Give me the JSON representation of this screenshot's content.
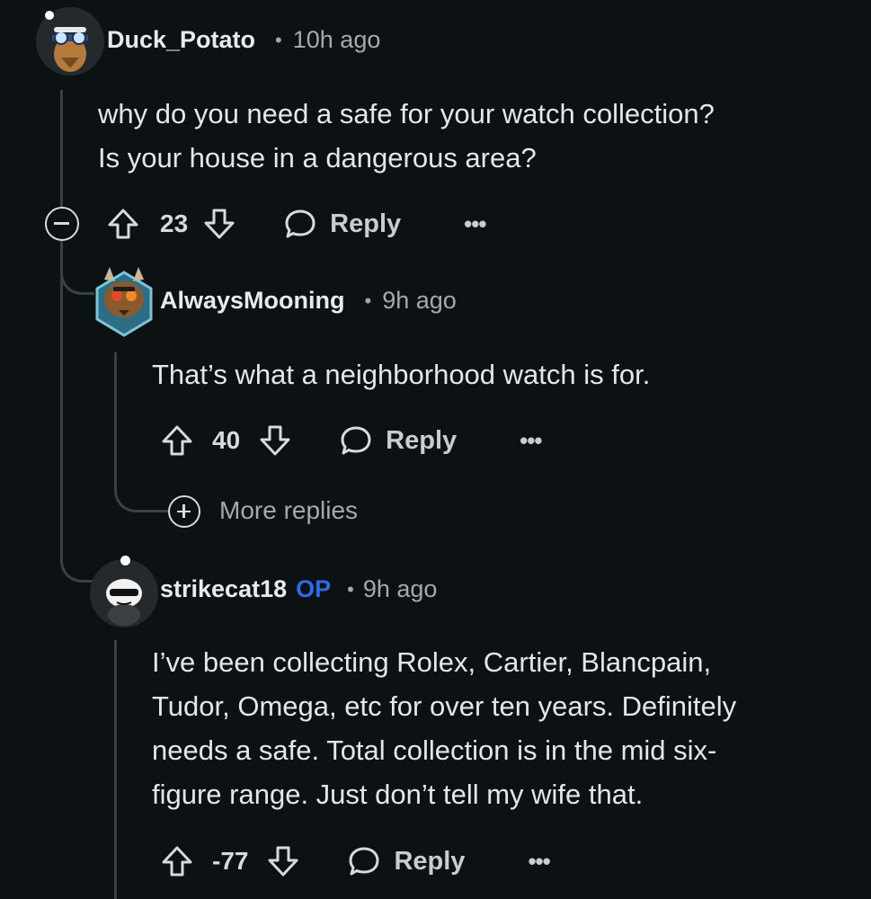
{
  "comments": [
    {
      "username": "Duck_Potato",
      "time": "10h ago",
      "body_lines": [
        "why do you need a safe for your watch collection?",
        "Is your house in a dangerous area?"
      ],
      "votes": "23",
      "reply_label": "Reply",
      "more_label": "•••"
    },
    {
      "username": "AlwaysMooning",
      "time": "9h ago",
      "body_lines": [
        "That’s what a neighborhood watch is for."
      ],
      "votes": "40",
      "reply_label": "Reply",
      "more_label": "•••",
      "more_replies_label": "More replies"
    },
    {
      "username": "strikecat18",
      "op_badge": "OP",
      "time": "9h ago",
      "body_lines": [
        "I’ve been collecting Rolex, Cartier, Blancpain,",
        "Tudor, Omega, etc for over ten years. Definitely",
        "needs a safe. Total collection is in the mid six-",
        "figure range. Just don’t tell my wife that."
      ],
      "votes": "-77",
      "reply_label": "Reply",
      "more_label": "•••"
    }
  ],
  "separator": "•",
  "colors": {
    "background": "#0c1114",
    "text": "#d7dadc",
    "muted": "#a4a9ad",
    "op_badge": "#2e6be6",
    "thread_line": "#3a4044"
  }
}
